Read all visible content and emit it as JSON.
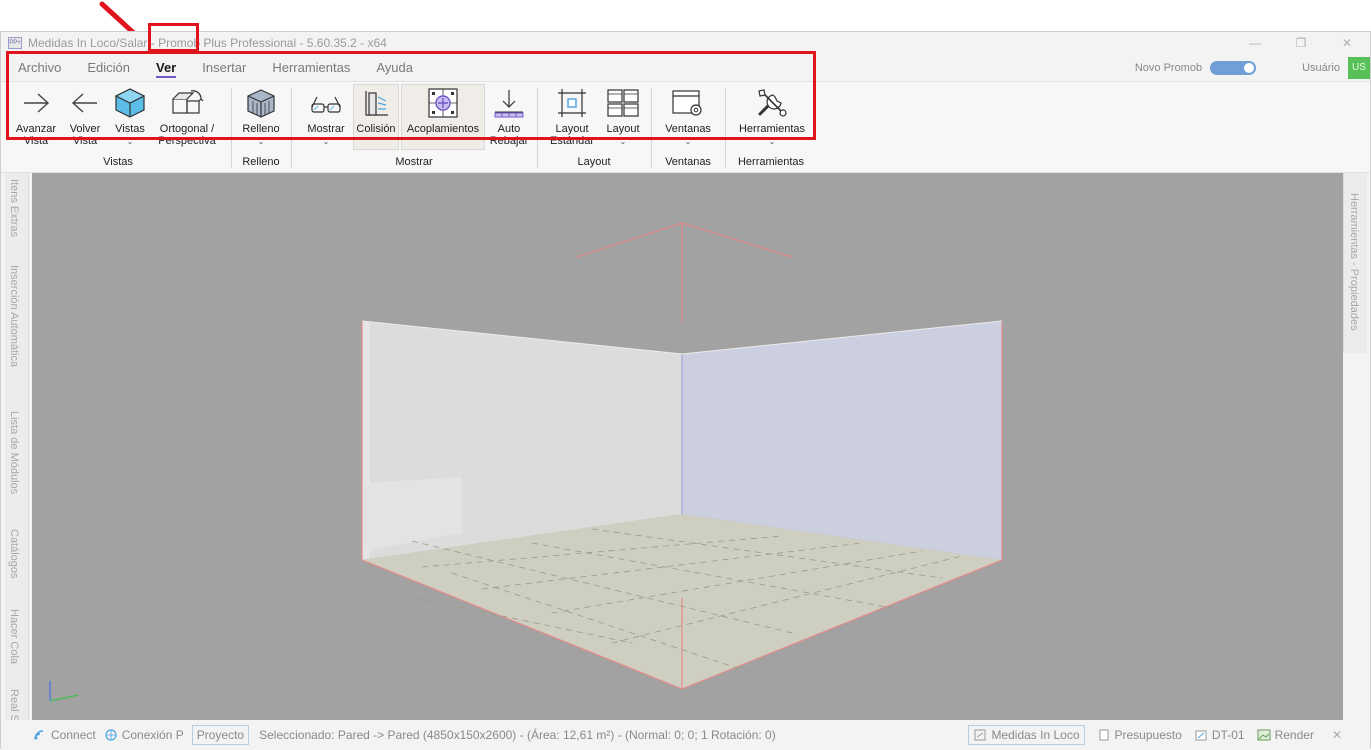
{
  "window": {
    "title": "Medidas In Loco/Salar - Promob Plus Professional - 5.60.35.2 - x64",
    "logo_text": "PP+"
  },
  "menu": {
    "tabs": [
      {
        "label": "Archivo"
      },
      {
        "label": "Edición"
      },
      {
        "label": "Ver"
      },
      {
        "label": "Insertar"
      },
      {
        "label": "Herramientas"
      },
      {
        "label": "Ayuda"
      }
    ],
    "active_tab": "Ver"
  },
  "topright": {
    "novo_label": "Novo Promob",
    "toggle_on": true,
    "user_label": "Usuário",
    "user_initials": "US"
  },
  "ribbon": {
    "groups": {
      "vistas": {
        "label": "Vistas",
        "avanzar": "Avanzar\nVista",
        "volver": "Volver\nVista",
        "vistas": "Vistas",
        "ortogonal": "Ortogonal /\nPerspectiva"
      },
      "relleno": {
        "label": "Relleno",
        "relleno": "Relleno"
      },
      "mostrar": {
        "label": "Mostrar",
        "mostrar": "Mostrar",
        "colision": "Colisión",
        "acoplamientos": "Acoplamientos",
        "auto_rebajar": "Auto\nRebajar"
      },
      "layout": {
        "label": "Layout",
        "layout_estandar": "Layout\nEstándar",
        "layout": "Layout"
      },
      "ventanas": {
        "label": "Ventanas",
        "ventanas": "Ventanas"
      },
      "herramientas": {
        "label": "Herramientas",
        "herramientas": "Herramientas"
      }
    },
    "chevron": "⌄"
  },
  "left_panel": {
    "tabs": [
      "Itens Extras",
      "Inserción Automática",
      "Lista de Módulos",
      "Catálogos",
      "Hacer Cola",
      "Real Scen"
    ]
  },
  "right_panel": {
    "tab": "Herramientas - Propiedades"
  },
  "status": {
    "connect": "Connect",
    "conexion": "Conexión P",
    "proyecto": "Proyecto",
    "message": "Seleccionado: Pared -> Pared (4850x150x2600) - (Área: 12,61 m²) - (Normal: 0; 0; 1 Rotación: 0)",
    "medidas": "Medidas In Loco",
    "presupuesto": "Presupuesto",
    "dt": "DT-01",
    "render": "Render",
    "close": "✕"
  },
  "colors": {
    "highlight": "#e0141d",
    "accent": "#7357c9",
    "viewport_bg": "#a2a2a2",
    "icon_blue": "#4aa3df"
  }
}
